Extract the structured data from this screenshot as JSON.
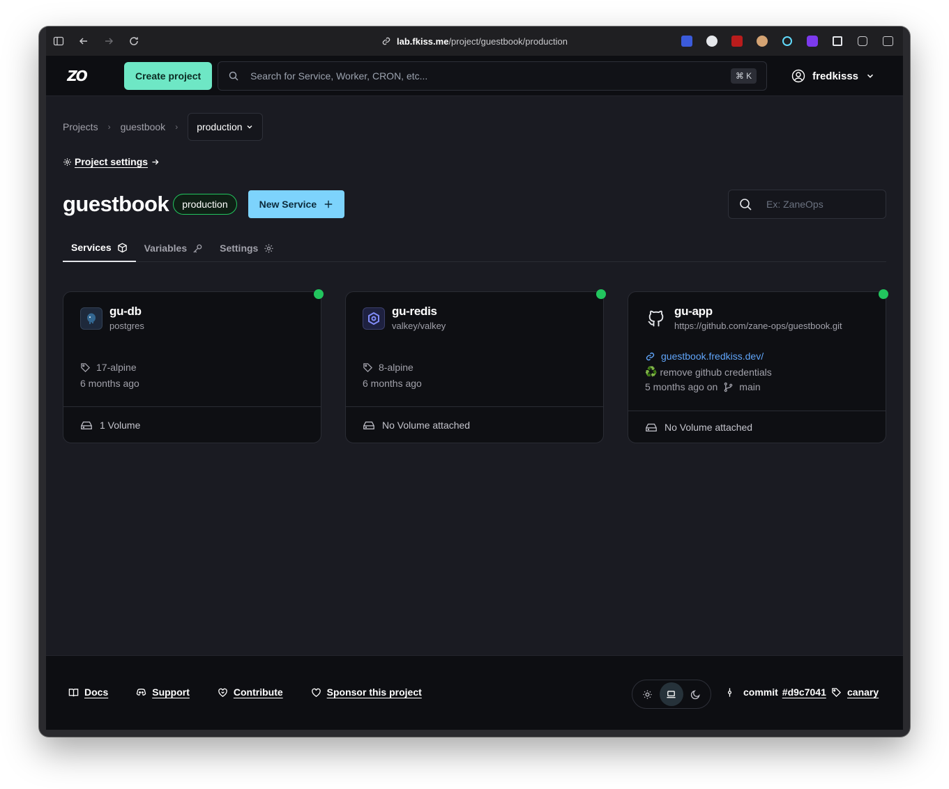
{
  "browser": {
    "url_host": "lab.fkiss.me",
    "url_path": "/project/guestbook/production"
  },
  "nav": {
    "logo": "ZO",
    "create_project": "Create project",
    "search_placeholder": "Search for Service, Worker, CRON, etc...",
    "search_shortcut": "⌘ K",
    "username": "fredkisss"
  },
  "breadcrumb": {
    "projects": "Projects",
    "project": "guestbook",
    "environment": "production"
  },
  "project_settings": "Project settings",
  "header": {
    "title": "guestbook",
    "env_badge": "production",
    "new_service": "New Service",
    "filter_placeholder": "Ex: ZaneOps"
  },
  "tabs": [
    {
      "label": "Services",
      "icon": "box-icon"
    },
    {
      "label": "Variables",
      "icon": "key-icon"
    },
    {
      "label": "Settings",
      "icon": "gear-icon"
    }
  ],
  "services": [
    {
      "name": "gu-db",
      "image": "postgres",
      "tag": "17-alpine",
      "updated": "6 months ago",
      "volume": "1 Volume",
      "status_color": "#22c55e",
      "icon": "postgres-icon"
    },
    {
      "name": "gu-redis",
      "image": "valkey/valkey",
      "tag": "8-alpine",
      "updated": "6 months ago",
      "volume": "No Volume attached",
      "status_color": "#22c55e",
      "icon": "valkey-icon"
    },
    {
      "name": "gu-app",
      "repo": "https://github.com/zane-ops/guestbook.git",
      "url": "guestbook.fredkiss.dev/",
      "commit_emoji": "♻️",
      "commit_message": "remove github credentials",
      "updated": "5 months ago on",
      "branch": "main",
      "volume": "No Volume attached",
      "status_color": "#22c55e",
      "icon": "github-icon"
    }
  ],
  "footer": {
    "docs": "Docs",
    "support": "Support",
    "contribute": "Contribute",
    "sponsor": "Sponsor this project",
    "commit_label": "commit",
    "commit_hash": "#d9c7041",
    "channel": "canary"
  }
}
